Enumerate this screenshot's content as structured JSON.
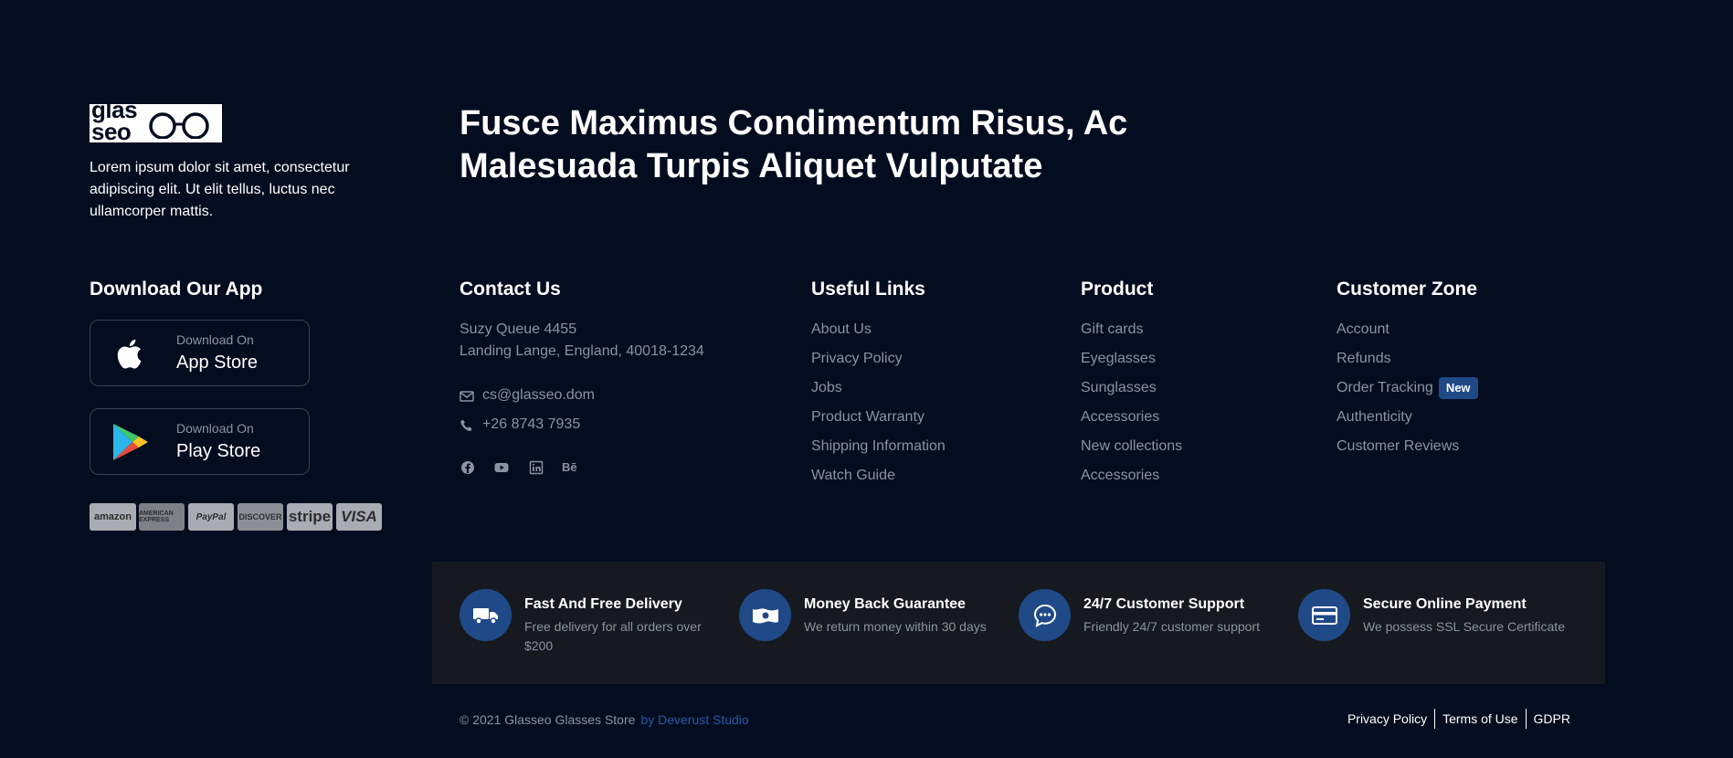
{
  "brand": {
    "logo_text": "glasseo",
    "logo_line1": "glas",
    "logo_line2": "seo",
    "intro": "Lorem ipsum dolor sit amet, consectetur adipiscing elit. Ut elit tellus, luctus nec ullamcorper mattis."
  },
  "headline": {
    "line1": "Fusce Maximus Condimentum Risus, Ac",
    "line2": "Malesuada Turpis Aliquet Vulputate"
  },
  "app": {
    "title": "Download Our App",
    "apple": {
      "small": "Download On",
      "big": "App Store",
      "icon": "apple-icon"
    },
    "google": {
      "small": "Download On",
      "big": "Play Store",
      "icon": "google-play-icon"
    },
    "payments": [
      "amazon",
      "AMERICAN EXPRESS",
      "PayPal",
      "DISCOVER",
      "stripe",
      "VISA"
    ]
  },
  "contact": {
    "title": "Contact Us",
    "address1": "Suzy Queue 4455",
    "address2": "Landing Lange, England, 40018-1234",
    "email": "cs@glasseo.dom",
    "phone": "+26 8743 7935",
    "socials": [
      "facebook-icon",
      "youtube-icon",
      "linkedin-icon",
      "behance-icon"
    ],
    "behance_text": "Bē"
  },
  "useful": {
    "title": "Useful Links",
    "items": [
      "About Us",
      "Privacy Policy",
      "Jobs",
      "Product Warranty",
      "Shipping Information",
      "Watch Guide"
    ]
  },
  "product": {
    "title": "Product",
    "items": [
      "Gift cards",
      "Eyeglasses",
      "Sunglasses",
      "Accessories",
      "New collections",
      "Accessories"
    ]
  },
  "customer": {
    "title": "Customer Zone",
    "items": [
      "Account",
      "Refunds",
      "Order Tracking",
      "Authenticity",
      "Customer Reviews"
    ],
    "badge": "New"
  },
  "features": [
    {
      "title": "Fast And Free Delivery",
      "desc": "Free delivery for all orders over $200",
      "icon": "truck-icon"
    },
    {
      "title": "Money Back Guarantee",
      "desc": "We return money within 30 days",
      "icon": "money-icon"
    },
    {
      "title": "24/7 Customer Support",
      "desc": "Friendly 24/7 customer support",
      "icon": "chat-icon"
    },
    {
      "title": "Secure Online Payment",
      "desc": "We possess SSL Secure Certificate",
      "icon": "credit-card-icon"
    }
  ],
  "footer": {
    "copyright": "© 2021 Glasseo Glasses Store",
    "credit": "by Deverust Studio",
    "links": [
      "Privacy Policy",
      "Terms of Use",
      "GDPR"
    ]
  },
  "colors": {
    "background": "#030d1f",
    "accent": "#1f4a87",
    "band": "#16191f",
    "muted": "#8b93a3"
  }
}
